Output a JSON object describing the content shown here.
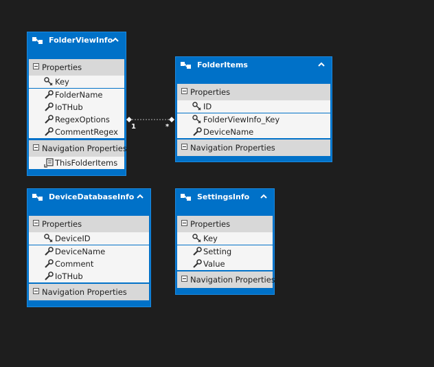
{
  "entities": {
    "folderviewinfo": {
      "title": "FolderViewInfo",
      "properties_label": "Properties",
      "properties": [
        "Key",
        "FolderName",
        "IoTHub",
        "RegexOptions",
        "CommentRegex"
      ],
      "navigation_label": "Navigation Properties",
      "navigation": [
        "ThisFolderItems"
      ]
    },
    "folderitems": {
      "title": "FolderItems",
      "properties_label": "Properties",
      "properties": [
        "ID",
        "FolderViewInfo_Key",
        "DeviceName"
      ],
      "navigation_label": "Navigation Properties"
    },
    "devicedatabaseinfo": {
      "title": "DeviceDatabaseInfo",
      "properties_label": "Properties",
      "properties": [
        "DeviceID",
        "DeviceName",
        "Comment",
        "IoTHub"
      ],
      "navigation_label": "Navigation Properties"
    },
    "settingsinfo": {
      "title": "SettingsInfo",
      "properties_label": "Properties",
      "properties": [
        "Key",
        "Setting",
        "Value"
      ],
      "navigation_label": "Navigation Properties"
    }
  },
  "association": {
    "from_multiplicity": "1",
    "to_multiplicity": "*"
  },
  "icons": {
    "entity": "entity-type-icon",
    "key": "key-icon",
    "property": "wrench-icon",
    "navigation": "navigation-property-icon",
    "collapse": "chevron-up-icon"
  },
  "colors": {
    "canvas": "#1e1e1e",
    "entity_header": "#0071c8",
    "section": "#d8d8d8",
    "body": "#f5f5f5"
  }
}
